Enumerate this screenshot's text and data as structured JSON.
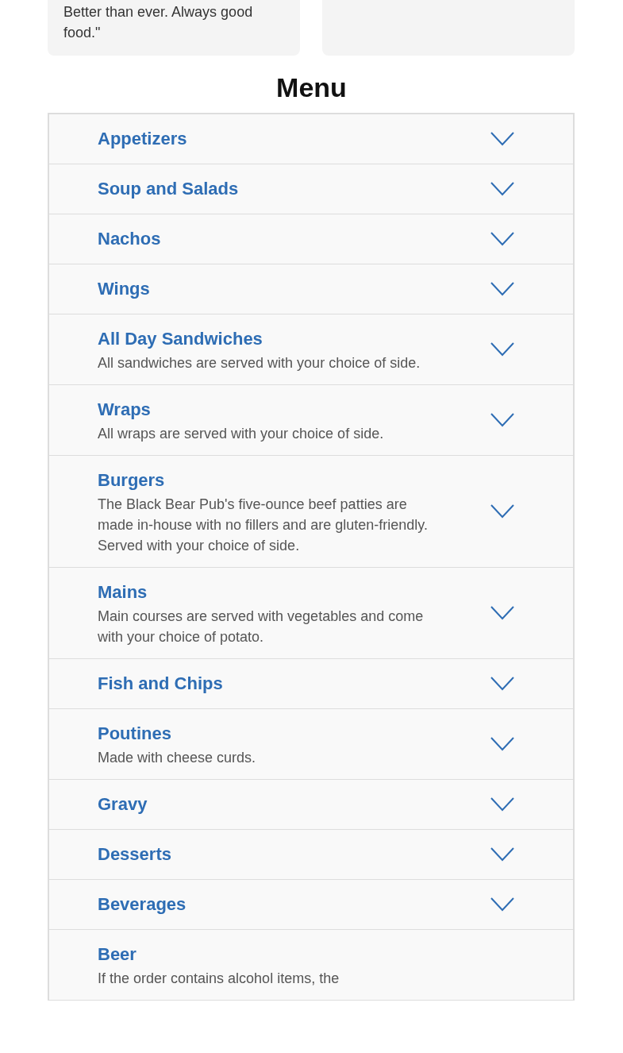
{
  "reviews": [
    {
      "kind": "quote",
      "text": "Better than ever. Always good food.\""
    },
    {
      "kind": "blank"
    }
  ],
  "menu": {
    "title": "Menu",
    "sections": [
      {
        "title": "Appetizers"
      },
      {
        "title": "Soup and Salads"
      },
      {
        "title": "Nachos"
      },
      {
        "title": "Wings"
      },
      {
        "title": "All Day Sandwiches",
        "description": "All sandwiches are served with your choice of side."
      },
      {
        "title": "Wraps",
        "description": "All wraps are served with your choice of side."
      },
      {
        "title": "Burgers",
        "description": "The Black Bear Pub's five-ounce beef patties are made in-house with no fillers and are gluten-friendly. Served with your choice of side."
      },
      {
        "title": "Mains",
        "description": "Main courses are served with vegetables and come with your choice of potato."
      },
      {
        "title": "Fish and Chips"
      },
      {
        "title": "Poutines",
        "description": "Made with cheese curds."
      },
      {
        "title": "Gravy"
      },
      {
        "title": "Desserts"
      },
      {
        "title": "Beverages"
      },
      {
        "title": "Beer",
        "description": "If the order contains alcohol items, the"
      }
    ]
  }
}
